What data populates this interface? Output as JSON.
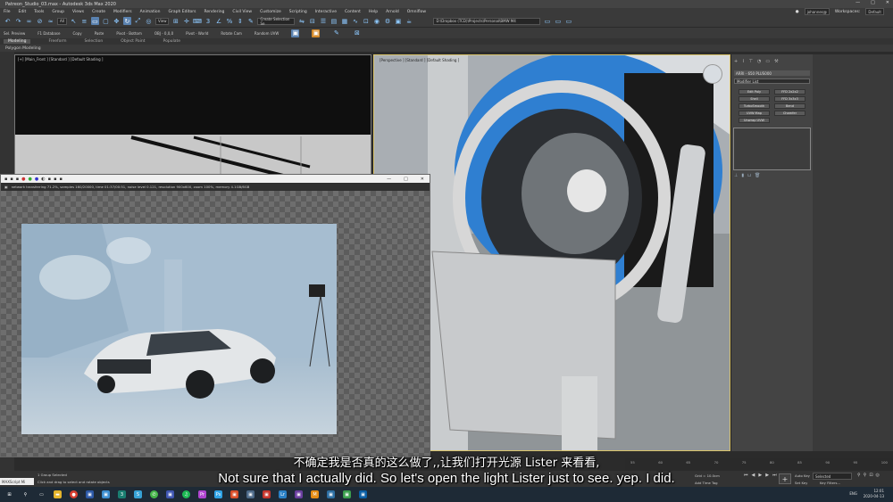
{
  "window": {
    "title": "Patreon_Studio_03.max - Autodesk 3ds Max 2020"
  },
  "menu": {
    "items": [
      "File",
      "Edit",
      "Tools",
      "Group",
      "Views",
      "Create",
      "Modifiers",
      "Animation",
      "Graph Editors",
      "Rendering",
      "Civil View",
      "Customize",
      "Scripting",
      "Interactive",
      "Content",
      "Help",
      "Arnold",
      "Omniflow"
    ],
    "user": "johannes@",
    "workspaces_label": "Workspaces:",
    "workspace_value": "Default"
  },
  "toolbar": {
    "filter_value": "All",
    "view_value": "View",
    "selection_set": "Create Selection Se",
    "project_path": "D:\\Dropbox (TCD)\\Projects\\Personal\\BMW M4"
  },
  "ribbon": {
    "items": [
      "Sel. Preview",
      "F1 Database",
      "Copy",
      "Paste",
      "Pivot - Bottom",
      "OBJ - 0,0,0",
      "Pivot - World",
      "Rotate Cam",
      "Random UVW"
    ]
  },
  "ribbon_tabs": {
    "items": [
      "Modeling",
      "Freeform",
      "Selection",
      "Object Paint",
      "Populate"
    ],
    "active": "Modeling"
  },
  "ribbon_sub": {
    "label": "Polygon Modeling"
  },
  "viewport_front": {
    "label": "[+] [Main_Front ] [Standard ] [Default Shading ]"
  },
  "viewport_persp": {
    "label": "[Perspective ] [Standard ] [Default Shading ]"
  },
  "command_panel": {
    "object_name": "ARRI - 650 PLUS000",
    "modifier_list": "Modifier List",
    "buttons": [
      "Edit Poly",
      "FFD 2x2x2",
      "Shell",
      "FFD 3x3x3",
      "TurboSmooth",
      "Bend",
      "UVW Map",
      "Chamfer",
      "Unwrap UVW",
      ""
    ]
  },
  "frame_buffer": {
    "status": "network transferring 71.2%, samples 160/20000, time 01:37/00:51, noise level 0.121, resolution 900x600, zoom 100%, memory 4.1GB/6GB"
  },
  "status": {
    "script_label": "MAXScript Mi",
    "selection": "1 Group Selected",
    "prompt": "Click and drag to select and rotate objects",
    "grid": "Grid = 10.0cm",
    "add_time_tag": "Add Time Tag",
    "auto_key": "Auto Key",
    "selected": "Selected",
    "set_key": "Set Key",
    "key_filters": "Key Filters..."
  },
  "timeline": {
    "ticks": [
      "55",
      "60",
      "65",
      "70",
      "75",
      "80",
      "85",
      "90",
      "95",
      "100"
    ]
  },
  "subtitles": {
    "chinese": "不确定我是否真的这么做了,,让我们打开光源 Lister 来看看,",
    "english": "Not sure that I actually did. So let's open the light Lister just to see. yep. I did."
  },
  "taskbar": {
    "time": "12:01",
    "date": "2020-04-13",
    "lang": "ENG"
  }
}
